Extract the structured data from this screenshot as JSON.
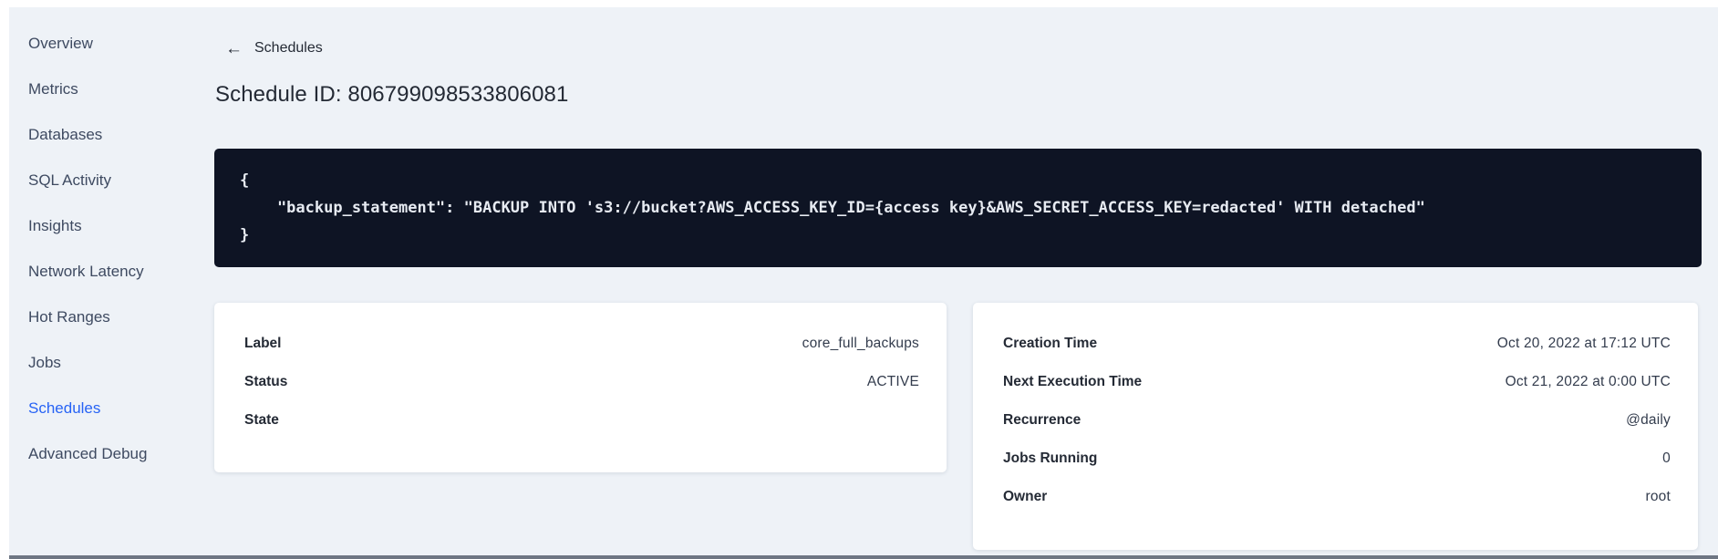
{
  "page": {
    "background": "#eef2f7",
    "bottom_edge_color": "#6e7683"
  },
  "sidebar": {
    "items": [
      {
        "label": "Overview",
        "active": false
      },
      {
        "label": "Metrics",
        "active": false
      },
      {
        "label": "Databases",
        "active": false
      },
      {
        "label": "SQL Activity",
        "active": false
      },
      {
        "label": "Insights",
        "active": false
      },
      {
        "label": "Network Latency",
        "active": false
      },
      {
        "label": "Hot Ranges",
        "active": false
      },
      {
        "label": "Jobs",
        "active": false
      },
      {
        "label": "Schedules",
        "active": true
      },
      {
        "label": "Advanced Debug",
        "active": false
      }
    ]
  },
  "header": {
    "back_icon": "←",
    "back_label": "Schedules",
    "title": "Schedule ID: 806799098533806081"
  },
  "schedule_definition": {
    "code": "{\n    \"backup_statement\": \"BACKUP INTO 's3://bucket?AWS_ACCESS_KEY_ID={access key}&AWS_SECRET_ACCESS_KEY=redacted' WITH detached\"\n}"
  },
  "status_card": {
    "rows": [
      {
        "label": "Label",
        "value": "core_full_backups"
      },
      {
        "label": "Status",
        "value": "ACTIVE"
      },
      {
        "label": "State",
        "value": ""
      }
    ]
  },
  "schedule_card": {
    "rows": [
      {
        "label": "Creation Time",
        "value": "Oct 20, 2022 at 17:12 UTC"
      },
      {
        "label": "Next Execution Time",
        "value": "Oct 21, 2022 at 0:00 UTC"
      },
      {
        "label": "Recurrence",
        "value": "@daily"
      },
      {
        "label": "Jobs Running",
        "value": "0"
      },
      {
        "label": "Owner",
        "value": "root"
      }
    ]
  },
  "colors": {
    "accent_blue": "#2763f5",
    "code_background": "#0e1424",
    "card_background": "#ffffff",
    "text_primary": "#242a35",
    "text_sidebar": "#3e4a61"
  }
}
